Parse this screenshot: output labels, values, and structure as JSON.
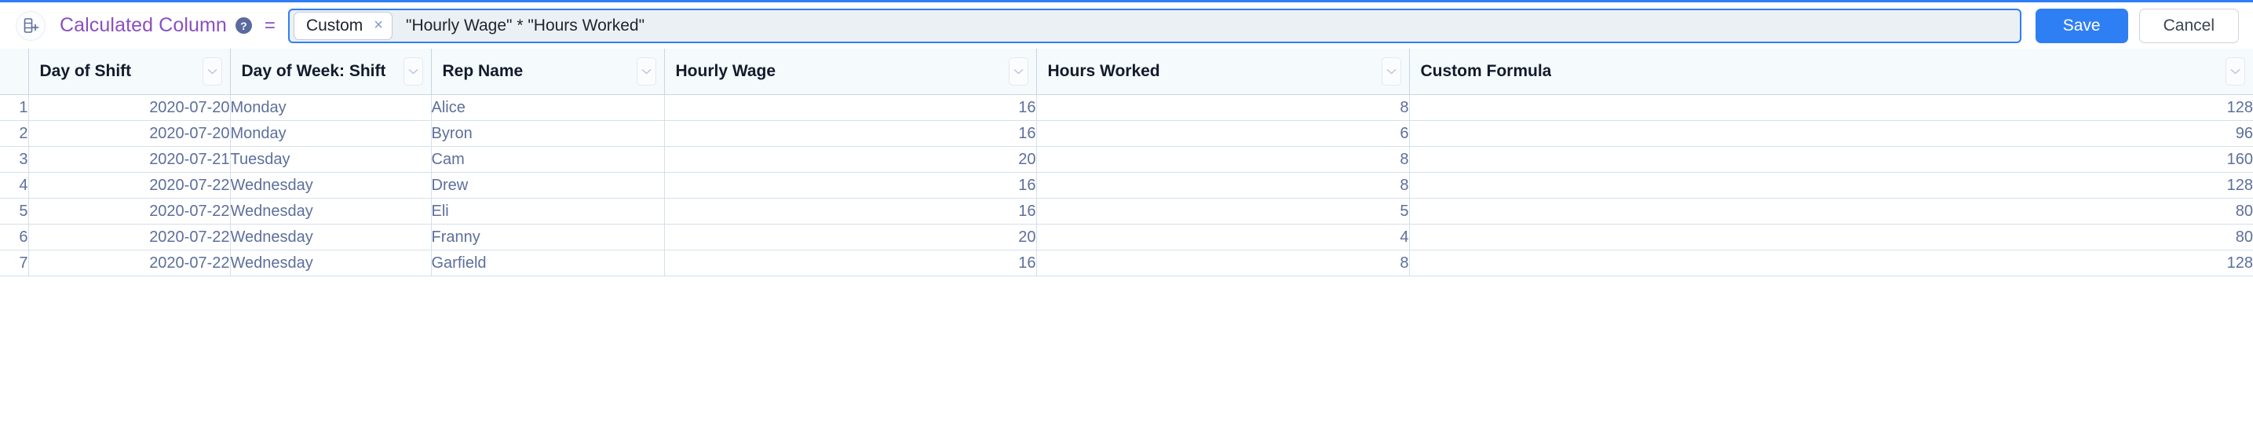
{
  "toolbar": {
    "column_icon": "add-column-icon",
    "title": "Calculated Column",
    "help_badge": "?",
    "equals": "=",
    "chip_label": "Custom",
    "chip_close": "×",
    "formula": "\"Hourly Wage\" * \"Hours Worked\"",
    "save_label": "Save",
    "cancel_label": "Cancel",
    "accent_blue": "#2f7ff4",
    "title_purple": "#8b4fc0"
  },
  "table": {
    "columns": [
      {
        "label": "Day of Shift",
        "align": "right"
      },
      {
        "label": "Day of Week: Shift",
        "align": "left"
      },
      {
        "label": "Rep Name",
        "align": "left"
      },
      {
        "label": "Hourly Wage",
        "align": "right"
      },
      {
        "label": "Hours Worked",
        "align": "right"
      },
      {
        "label": "Custom Formula",
        "align": "right"
      }
    ],
    "rows": [
      {
        "n": "1",
        "day_of_shift": "2020-07-20",
        "day_of_week": "Monday",
        "rep_name": "Alice",
        "hourly_wage": "16",
        "hours_worked": "8",
        "custom_formula": "128"
      },
      {
        "n": "2",
        "day_of_shift": "2020-07-20",
        "day_of_week": "Monday",
        "rep_name": "Byron",
        "hourly_wage": "16",
        "hours_worked": "6",
        "custom_formula": "96"
      },
      {
        "n": "3",
        "day_of_shift": "2020-07-21",
        "day_of_week": "Tuesday",
        "rep_name": "Cam",
        "hourly_wage": "20",
        "hours_worked": "8",
        "custom_formula": "160"
      },
      {
        "n": "4",
        "day_of_shift": "2020-07-22",
        "day_of_week": "Wednesday",
        "rep_name": "Drew",
        "hourly_wage": "16",
        "hours_worked": "8",
        "custom_formula": "128"
      },
      {
        "n": "5",
        "day_of_shift": "2020-07-22",
        "day_of_week": "Wednesday",
        "rep_name": "Eli",
        "hourly_wage": "16",
        "hours_worked": "5",
        "custom_formula": "80"
      },
      {
        "n": "6",
        "day_of_shift": "2020-07-22",
        "day_of_week": "Wednesday",
        "rep_name": "Franny",
        "hourly_wage": "20",
        "hours_worked": "4",
        "custom_formula": "80"
      },
      {
        "n": "7",
        "day_of_shift": "2020-07-22",
        "day_of_week": "Wednesday",
        "rep_name": "Garfield",
        "hourly_wage": "16",
        "hours_worked": "8",
        "custom_formula": "128"
      }
    ]
  }
}
